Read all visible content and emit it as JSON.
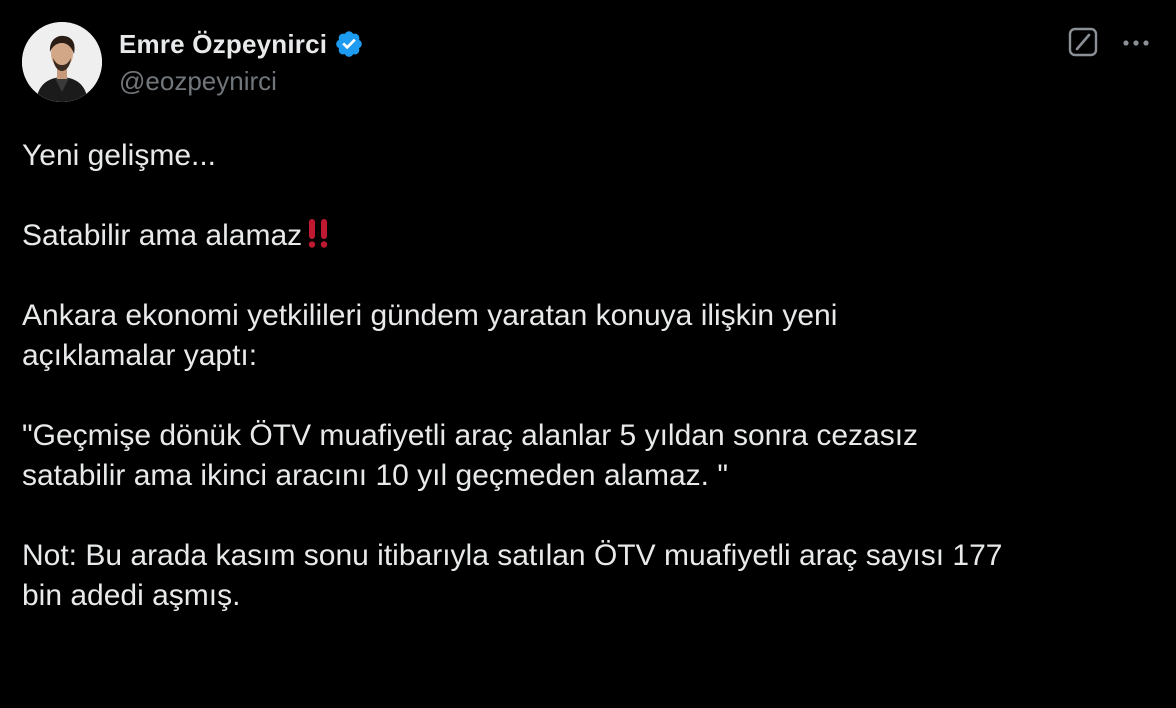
{
  "author": {
    "display_name": "Emre Özpeynirci",
    "handle": "@eozpeynirci",
    "verified": true,
    "verified_color": "#1d9bf0",
    "avatar_icon": "profile-photo"
  },
  "actions": {
    "grok_icon": "grok-icon",
    "more_icon": "more-options-icon"
  },
  "tweet": {
    "line1": "Yeni gelişme...",
    "line2": "Satabilir ama alamaz",
    "line2_emoji": "double-exclamation-icon",
    "line3a": "Ankara ekonomi yetkilileri gündem yaratan konuya ilişkin yeni",
    "line3b": "açıklamalar yaptı:",
    "line4a": "\"Geçmişe dönük ÖTV muafiyetli araç alanlar 5 yıldan sonra cezasız",
    "line4b": "satabilir ama ikinci aracını 10 yıl geçmeden alamaz. \"",
    "line5a": "Not: Bu arada kasım sonu itibarıyla satılan ÖTV muafiyetli araç sayısı 177",
    "line5b": "bin adedi aşmış."
  },
  "colors": {
    "background": "#000000",
    "text_primary": "#e7e9ea",
    "text_secondary": "#71767b",
    "emoji_red": "#be1931"
  }
}
